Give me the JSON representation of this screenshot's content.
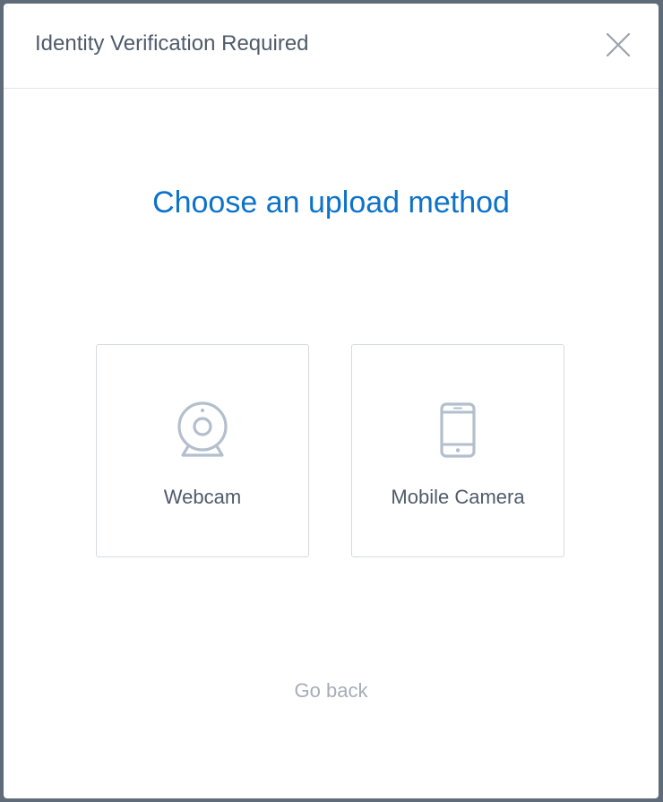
{
  "modal": {
    "title": "Identity Verification Required",
    "close_icon": "close-icon"
  },
  "main": {
    "heading": "Choose an upload method",
    "options": [
      {
        "label": "Webcam",
        "icon": "webcam-icon"
      },
      {
        "label": "Mobile Camera",
        "icon": "mobile-phone-icon"
      }
    ],
    "go_back_label": "Go back"
  },
  "colors": {
    "heading": "#0d72c9",
    "title_text": "#4f5b6b",
    "muted_text": "#a6adb7",
    "icon_stroke": "#b3bfcc",
    "border": "#d5dae1",
    "backdrop": "#5f6b78"
  }
}
